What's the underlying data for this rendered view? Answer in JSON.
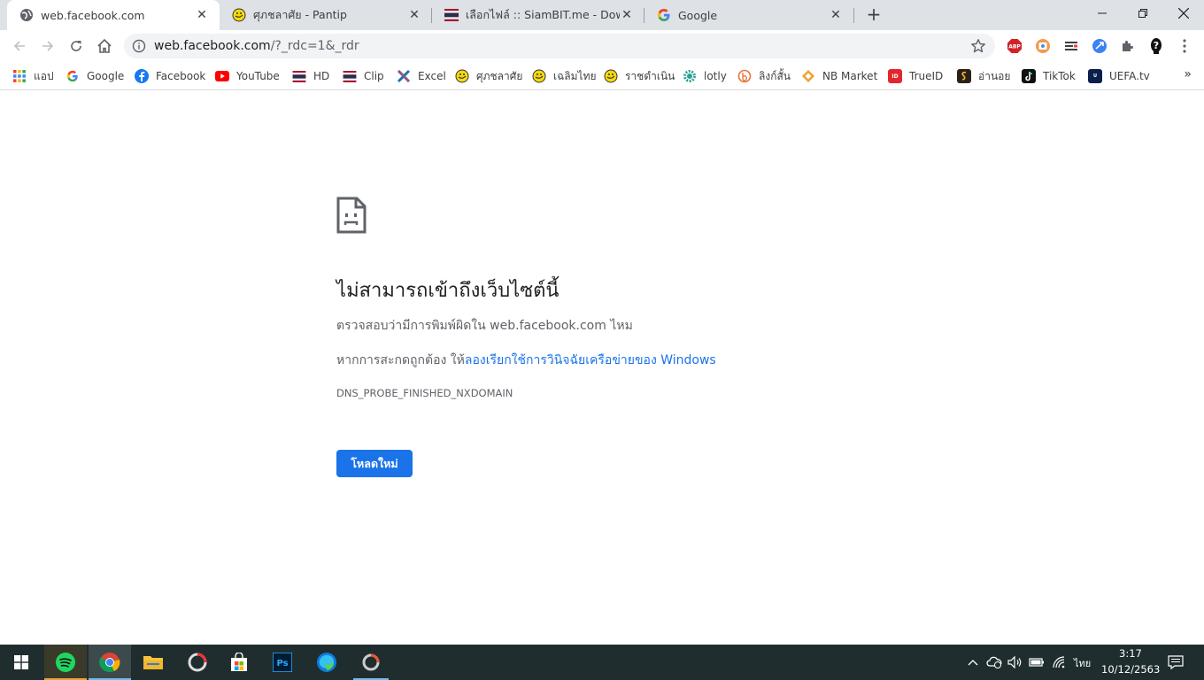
{
  "tabs": [
    {
      "title": "web.facebook.com",
      "active": true,
      "favicon": "globe-icon"
    },
    {
      "title": "ศุภชลาศัย - Pantip",
      "active": false,
      "favicon": "pantip-icon"
    },
    {
      "title": "เลือกไฟล์ :: SiamBIT.me - Downloa",
      "active": false,
      "favicon": "thai-flag-icon"
    },
    {
      "title": "Google",
      "active": false,
      "favicon": "google-icon"
    }
  ],
  "toolbar": {
    "url_host": "web.facebook.com",
    "url_path": "/?_rdc=1&_rdr"
  },
  "bookmarks": [
    {
      "label": "แอป",
      "icon": "apps-grid-icon"
    },
    {
      "label": "Google",
      "icon": "google-icon"
    },
    {
      "label": "Facebook",
      "icon": "facebook-icon"
    },
    {
      "label": "YouTube",
      "icon": "youtube-icon"
    },
    {
      "label": "HD",
      "icon": "thai-flag-icon"
    },
    {
      "label": "Clip",
      "icon": "thai-flag-icon"
    },
    {
      "label": "Excel",
      "icon": "excel-icon"
    },
    {
      "label": "ศุภชลาศัย",
      "icon": "pantip-icon"
    },
    {
      "label": "เฉลิมไทย",
      "icon": "pantip-icon"
    },
    {
      "label": "ราชดำเนิน",
      "icon": "pantip-icon"
    },
    {
      "label": "lotly",
      "icon": "gear-icon"
    },
    {
      "label": "ลิงก์สั้น",
      "icon": "shortlink-icon"
    },
    {
      "label": "NB Market",
      "icon": "diamond-icon"
    },
    {
      "label": "TrueID",
      "icon": "trueid-icon"
    },
    {
      "label": "อ่านอย",
      "icon": "reader-icon"
    },
    {
      "label": "TikTok",
      "icon": "tiktok-icon"
    },
    {
      "label": "UEFA.tv",
      "icon": "uefa-icon"
    }
  ],
  "error": {
    "title": "ไม่สามารถเข้าถึงเว็บไซต์นี้",
    "line1_prefix": "ตรวจสอบว่ามีการพิมพ์ผิดใน ",
    "line1_host": "web.facebook.com",
    "line1_suffix": " ไหม",
    "line2_prefix": "หากการสะกดถูกต้อง ให้",
    "line2_link": "ลองเรียกใช้การวินิจฉัยเครือข่ายของ Windows",
    "code": "DNS_PROBE_FINISHED_NXDOMAIN",
    "reload_label": "โหลดใหม่"
  },
  "taskbar": {
    "language": "ไทย",
    "time": "3:17",
    "date": "10/12/2563"
  },
  "colors": {
    "accent": "#1a73e8",
    "tabstrip": "#dee1e6",
    "taskbar": "#1f2d2f"
  }
}
